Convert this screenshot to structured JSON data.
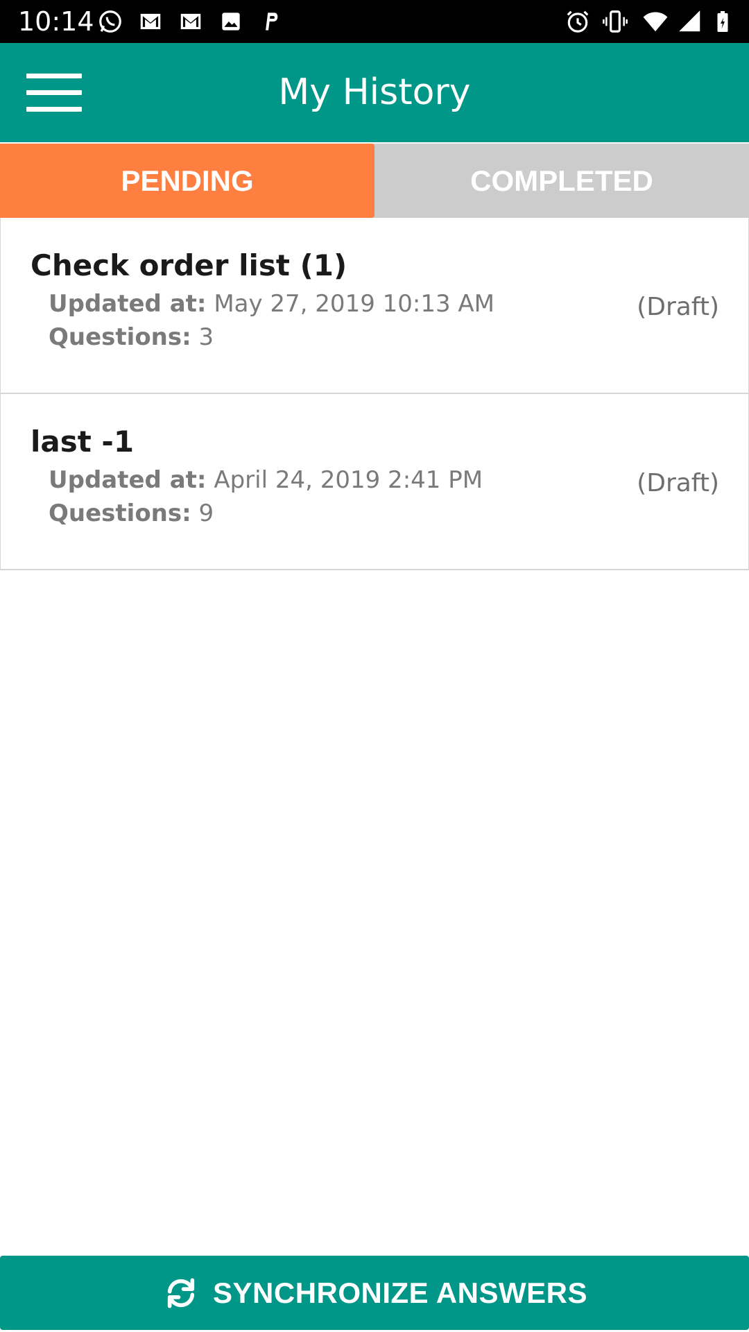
{
  "status_bar": {
    "time": "10:14",
    "icons_left": [
      "whatsapp-icon",
      "gmail-icon",
      "gmail-icon",
      "image-icon",
      "p-app-icon"
    ],
    "icons_right": [
      "alarm-icon",
      "vibrate-icon",
      "wifi-icon",
      "signal-icon",
      "battery-icon"
    ]
  },
  "app_bar": {
    "title": "My History",
    "menu_icon": "hamburger-menu-icon"
  },
  "tabs": [
    {
      "label": "PENDING",
      "active": true
    },
    {
      "label": "COMPLETED",
      "active": false
    }
  ],
  "items": [
    {
      "title": "Check order list (1)",
      "updated_label": "Updated at:",
      "updated_value": " May 27, 2019 10:13 AM",
      "questions_label": "Questions:",
      "questions_value": " 3",
      "status": "(Draft)"
    },
    {
      "title": "last -1",
      "updated_label": "Updated at:",
      "updated_value": " April 24, 2019 2:41 PM",
      "questions_label": "Questions:",
      "questions_value": " 9",
      "status": "(Draft)"
    }
  ],
  "footer": {
    "sync_label": "SYNCHRONIZE ANSWERS",
    "sync_icon": "sync-icon"
  },
  "colors": {
    "primary": "#009688",
    "active_tab": "#ff7f41",
    "inactive_tab": "#cccccc",
    "status_bar": "#000000"
  }
}
